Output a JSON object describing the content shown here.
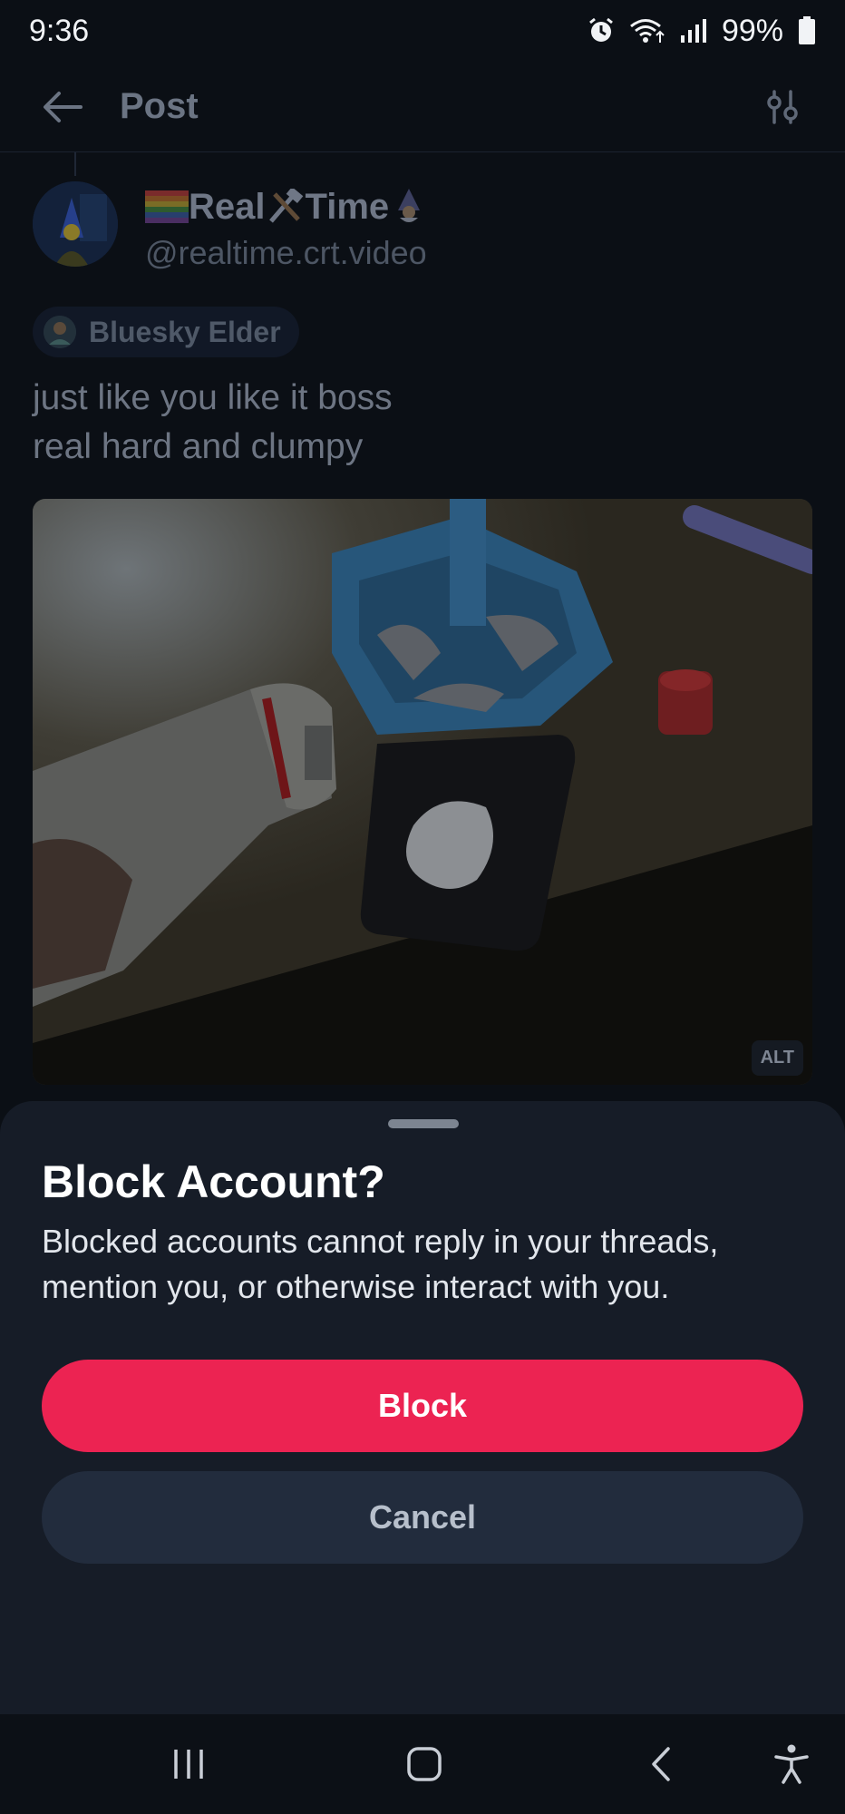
{
  "status_bar": {
    "time": "9:36",
    "battery": "99%"
  },
  "header": {
    "title": "Post"
  },
  "post": {
    "author_name": "Real",
    "author_name_2": "Time",
    "handle": "@realtime.crt.video",
    "badge": "Bluesky Elder",
    "text_line_1": "just like you like it boss",
    "text_line_2": "real hard and clumpy",
    "alt_label": "ALT"
  },
  "dialog": {
    "title": "Block Account?",
    "description": "Blocked accounts cannot reply in your threads, mention you, or otherwise interact with you.",
    "confirm_label": "Block",
    "cancel_label": "Cancel"
  },
  "colors": {
    "accent_danger": "#ec2352",
    "sheet_bg": "#161c27",
    "app_bg": "#0b0f15"
  },
  "icons": [
    "back-arrow-icon",
    "filter-icon",
    "alarm-icon",
    "wifi-icon",
    "signal-icon",
    "battery-icon",
    "recent-apps-icon",
    "home-icon",
    "back-icon",
    "accessibility-icon"
  ]
}
